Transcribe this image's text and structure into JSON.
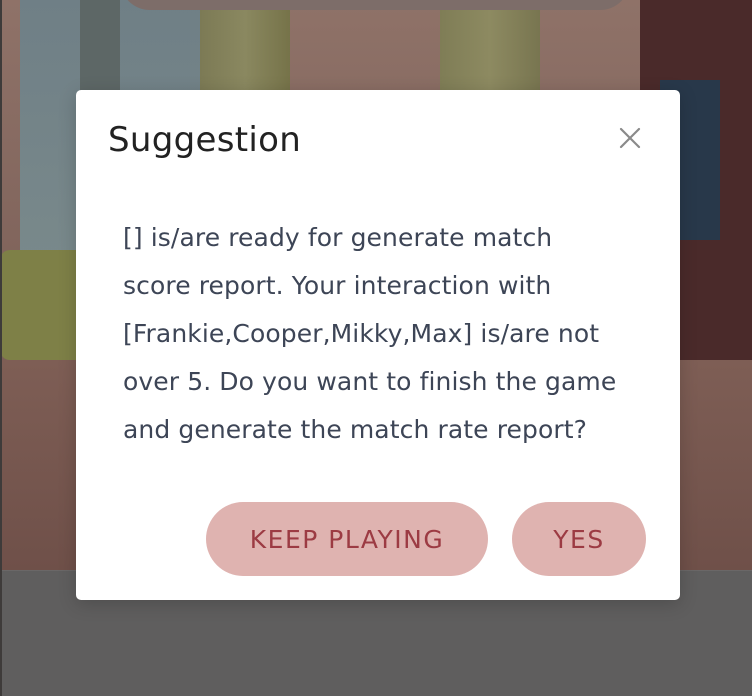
{
  "dialog": {
    "title": "Suggestion",
    "message": "[] is/are ready for generate match\nscore report. Your interaction with\n[Frankie,Cooper,Mikky,Max] is/are not\nover 5. Do you want to finish the game\nand generate the match rate report?",
    "close_icon": "close-icon",
    "buttons": {
      "keep_playing": "KEEP PLAYING",
      "yes": "YES"
    }
  },
  "colors": {
    "overlay_tint": "#6d625f",
    "button_bg": "#dfb3b0",
    "button_text": "#9c3b43",
    "title_text": "#222222",
    "body_text": "#3d4556"
  }
}
